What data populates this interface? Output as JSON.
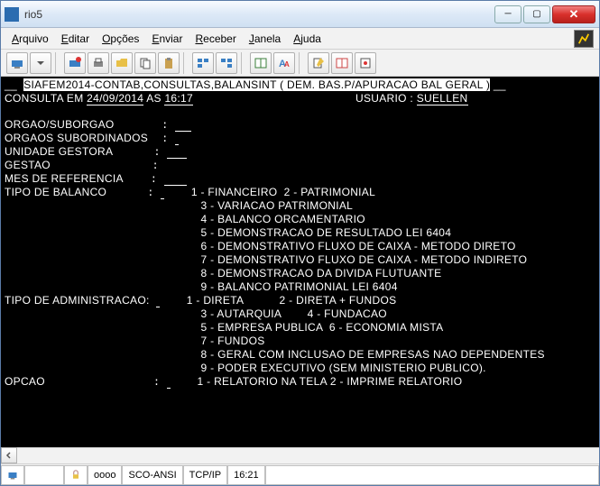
{
  "window": {
    "title": "rio5"
  },
  "menu": {
    "items": [
      {
        "u": "A",
        "rest": "rquivo"
      },
      {
        "u": "E",
        "rest": "ditar"
      },
      {
        "u": "O",
        "rest": "pções"
      },
      {
        "u": "E",
        "rest": "nviar"
      },
      {
        "u": "R",
        "rest": "eceber"
      },
      {
        "u": "J",
        "rest": "anela"
      },
      {
        "u": "A",
        "rest": "juda"
      }
    ]
  },
  "term": {
    "hdr_pre": "__  ",
    "hdr": "SIAFEM2014-CONTAB,CONSULTAS,BALANSINT ( DEM. BAS.P/APURACAO BAL GERAL )",
    "hdr_post": " __",
    "consulta_lbl": "CONSULTA EM ",
    "date": "24/09/2014",
    "as": " AS ",
    "time": "16:17",
    "user_lbl": "USUARIO : ",
    "user": "SUELLEN",
    "f_orgao": "ORGAO/SUBORGAO",
    "f_sub": "ORGAOS SUBORDINADOS",
    "f_ug": "UNIDADE GESTORA",
    "f_gestao": "GESTAO",
    "f_mes": "MES DE REFERENCIA",
    "f_tipo": "TIPO DE BALANCO",
    "tipo_l1": "1 - FINANCEIRO  2 - PATRIMONIAL",
    "tipo_l2": "3 - VARIACAO PATRIMONIAL",
    "tipo_l3": "4 - BALANCO ORCAMENTARIO",
    "tipo_l4": "5 - DEMONSTRACAO DE RESULTADO LEI 6404",
    "tipo_l5": "6 - DEMONSTRATIVO FLUXO DE CAIXA - METODO DIRETO",
    "tipo_l6": "7 - DEMONSTRATIVO FLUXO DE CAIXA - METODO INDIRETO",
    "tipo_l7": "8 - DEMONSTRACAO DA DIVIDA FLUTUANTE",
    "tipo_l8": "9 - BALANCO PATRIMONIAL LEI 6404",
    "f_admin": "TIPO DE ADMINISTRACAO:",
    "adm_l1": "1 - DIRETA           2 - DIRETA + FUNDOS",
    "adm_l2": "3 - AUTARQUIA        4 - FUNDACAO",
    "adm_l3": "5 - EMPRESA PUBLICA  6 - ECONOMIA MISTA",
    "adm_l4": "7 - FUNDOS",
    "adm_l5": "8 - GERAL COM INCLUSAO DE EMPRESAS NAO DEPENDENTES",
    "adm_l6": "9 - PODER EXECUTIVO (SEM MINISTERIO PUBLICO).",
    "f_opcao": "OPCAO",
    "opc_l1": "1 - RELATORIO NA TELA 2 - IMPRIME RELATORIO"
  },
  "status": {
    "caps": "oooo",
    "encoding": "SCO-ANSI",
    "proto": "TCP/IP",
    "clock": "16:21"
  }
}
